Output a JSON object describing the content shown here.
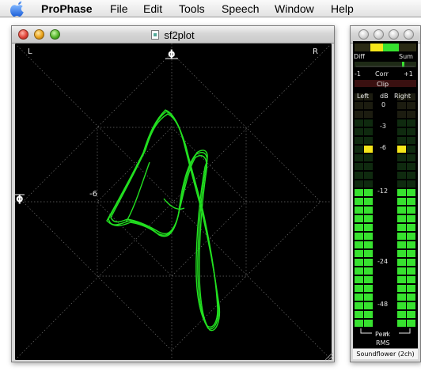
{
  "menubar": {
    "app_name": "ProPhase",
    "items": [
      "File",
      "Edit",
      "Tools",
      "Speech",
      "Window",
      "Help"
    ]
  },
  "plot_window": {
    "title": "sf2plot",
    "labels": {
      "left": "L",
      "right": "R",
      "top_phi": "ϕ",
      "left_phi": "ϕ",
      "minus6": "-6"
    }
  },
  "meter_window": {
    "diff_label": "Diff",
    "sum_label": "Sum",
    "corr_min": "-1",
    "corr_label": "Corr",
    "corr_max": "+1",
    "clip_label": "Clip",
    "left_label": "Left",
    "db_label": "dB",
    "right_label": "Right",
    "db_scale": [
      "0",
      "-3",
      "-6",
      "-12",
      "-24",
      "-48"
    ],
    "peak_label": "Peak",
    "rms_label": "RMS",
    "device": "Soundflower (2ch)",
    "left_level_db": -6,
    "right_level_db": -6
  },
  "colors": {
    "trace": "#22e020",
    "meter_on": "#37e22f",
    "meter_yellow": "#f5e61a",
    "grid": "#6b6b6b"
  }
}
